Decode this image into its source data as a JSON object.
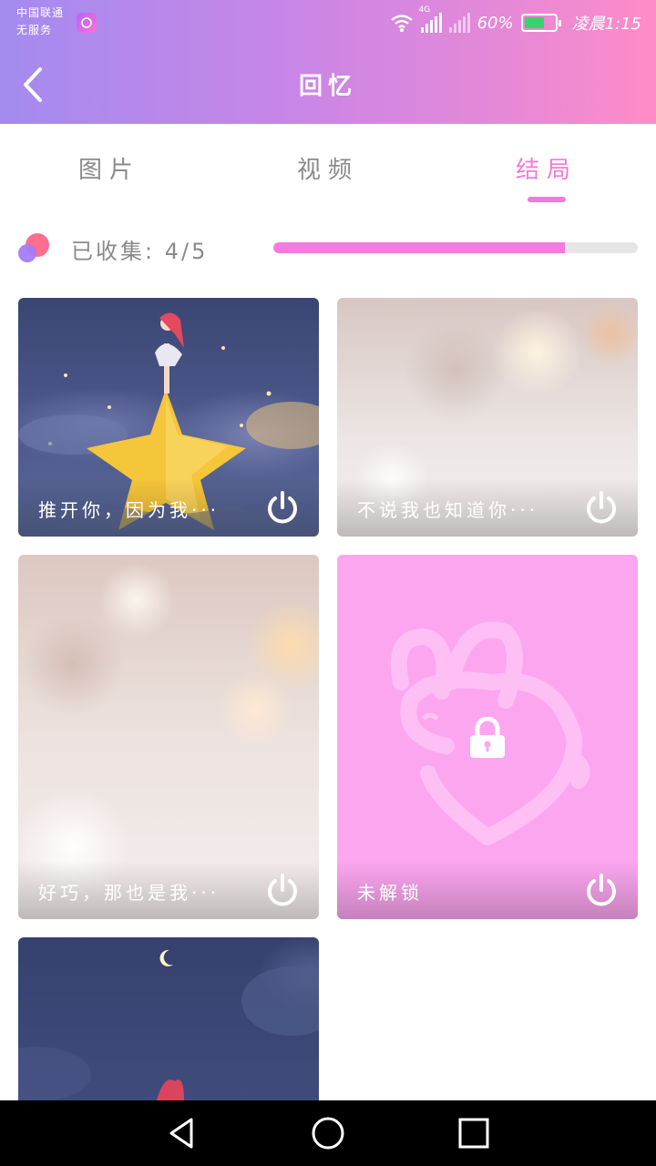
{
  "status_bar": {
    "carrier_line1": "中国联通",
    "carrier_line2": "无服务",
    "network": "4G",
    "battery": "60%",
    "time": "凌晨1:15"
  },
  "header": {
    "title": "回忆"
  },
  "tabs": [
    {
      "label": "图片",
      "active": false
    },
    {
      "label": "视频",
      "active": false
    },
    {
      "label": "结局",
      "active": true
    }
  ],
  "progress": {
    "label": "已收集: 4/5",
    "collected": 4,
    "total": 5,
    "fraction": 0.8
  },
  "cards": [
    {
      "caption": "推开你，因为我···",
      "state": "unlocked"
    },
    {
      "caption": "不说我也知道你···",
      "state": "unlocked"
    },
    {
      "caption": "好巧，那也是我···",
      "state": "unlocked"
    },
    {
      "caption": "未解锁",
      "state": "locked"
    },
    {
      "caption": "",
      "state": "unlocked"
    }
  ],
  "colors": {
    "accent": "#f37ad9",
    "progress_fill": "#f57adf",
    "locked_card": "#fca6f0",
    "header_start": "#a48bef",
    "header_end": "#ff8cc8"
  },
  "icons": {
    "back": "chevron-left-icon",
    "power": "power-icon",
    "lock": "lock-icon",
    "nav_back": "triangle-back-icon",
    "nav_home": "circle-home-icon",
    "nav_recents": "square-recents-icon"
  }
}
